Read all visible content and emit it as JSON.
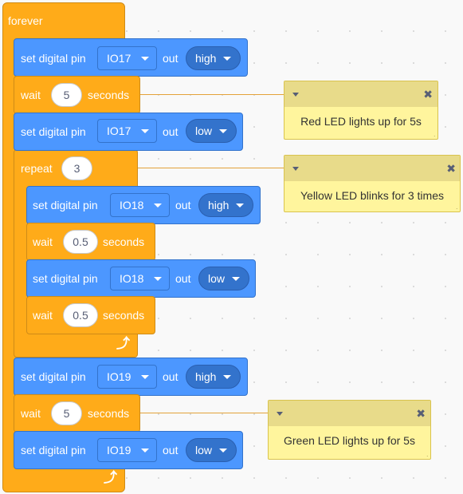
{
  "blocks": {
    "forever": {
      "label": "forever"
    },
    "b1": {
      "text": "set digital pin",
      "pin": "IO17",
      "out": "out",
      "level": "high"
    },
    "w1": {
      "label": "wait",
      "value": "5",
      "unit": "seconds"
    },
    "b2": {
      "text": "set digital pin",
      "pin": "IO17",
      "out": "out",
      "level": "low"
    },
    "repeat": {
      "label": "repeat",
      "value": "3"
    },
    "b3": {
      "text": "set digital pin",
      "pin": "IO18",
      "out": "out",
      "level": "high"
    },
    "w2": {
      "label": "wait",
      "value": "0.5",
      "unit": "seconds"
    },
    "b4": {
      "text": "set digital pin",
      "pin": "IO18",
      "out": "out",
      "level": "low"
    },
    "w3": {
      "label": "wait",
      "value": "0.5",
      "unit": "seconds"
    },
    "b5": {
      "text": "set digital pin",
      "pin": "IO19",
      "out": "out",
      "level": "high"
    },
    "w4": {
      "label": "wait",
      "value": "5",
      "unit": "seconds"
    },
    "b6": {
      "text": "set digital pin",
      "pin": "IO19",
      "out": "out",
      "level": "low"
    }
  },
  "comments": [
    {
      "text": "Red LED lights up for 5s"
    },
    {
      "text": "Yellow LED blinks for 3 times"
    },
    {
      "text": "Green LED lights up for 5s"
    }
  ],
  "icons": {
    "loop": "loop-arrow-icon",
    "dropdown": "caret-down-icon",
    "close": "close-icon",
    "collapse": "collapse-triangle-icon",
    "resize": "resize-grip-icon"
  },
  "colors": {
    "control": "#ffab19",
    "control_border": "#cf8b17",
    "pin_blocks": "#4c97ff",
    "pin_dark": "#3373cc",
    "comment": "#fff59d",
    "comment_header": "#e8db8a"
  }
}
